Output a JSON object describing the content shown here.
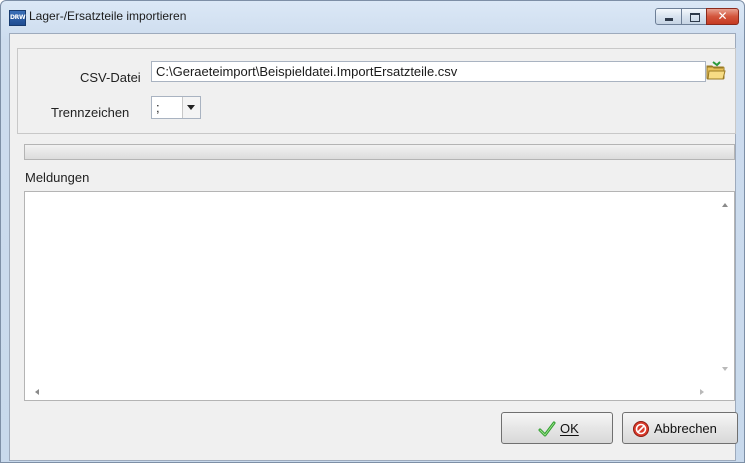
{
  "window": {
    "title": "Lager-/Ersatzteile importieren",
    "app_icon_text": "DRW"
  },
  "form": {
    "csv_label": "CSV-Datei",
    "csv_value": "C:\\Geraeteimport\\Beispieldatei.ImportErsatzteile.csv",
    "separator_label": "Trennzeichen",
    "separator_value": ";"
  },
  "progress": {
    "fraction": 0
  },
  "messages": {
    "label": "Meldungen",
    "lines": []
  },
  "buttons": {
    "ok_label": "OK",
    "cancel_label": "Abbrechen"
  },
  "colors": {
    "window_frame": "#c8d9ec",
    "client_bg": "#f0f0f0",
    "close_button": "#d3553c"
  },
  "icons": {
    "window": "drw-app-icon",
    "open_file": "folder-open-icon",
    "ok": "checkmark-icon",
    "cancel": "cancel-icon"
  }
}
